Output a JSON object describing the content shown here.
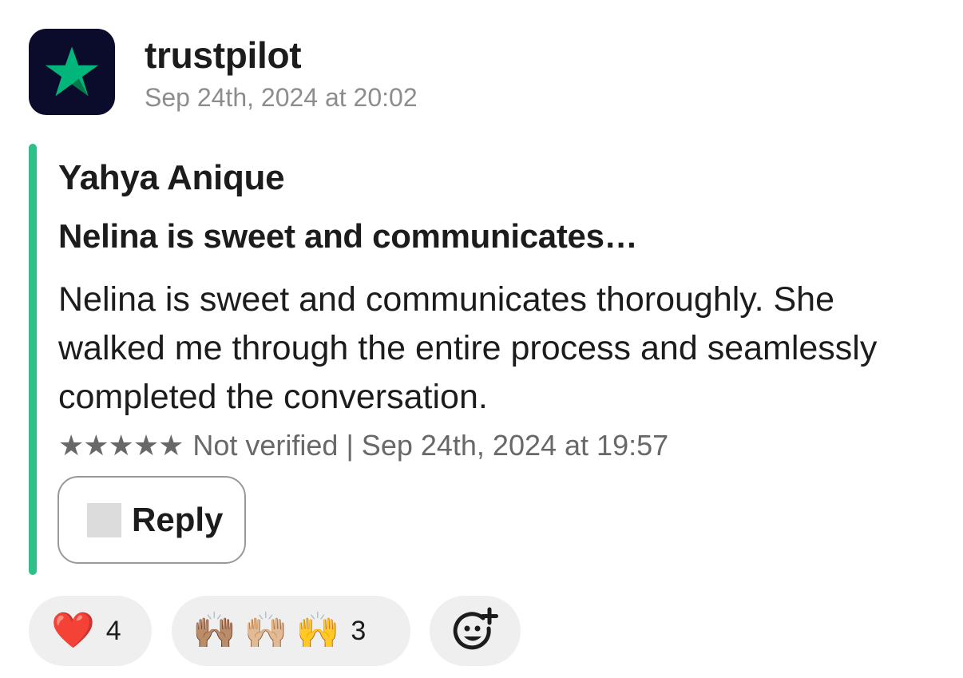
{
  "message": {
    "app_name": "trustpilot",
    "timestamp": "Sep 24th, 2024 at 20:02",
    "avatar_icon": "trustpilot-star-icon",
    "accent_color": "#2ec088"
  },
  "review": {
    "reviewer": "Yahya Anique",
    "title": "Nelina is sweet and communicates…",
    "body": "Nelina is sweet and communicates thoroughly. She walked me through the entire process and seamlessly completed the conversation.",
    "stars": "★★★★★",
    "rating": 5,
    "meta": "Not verified | Sep 24th, 2024 at 19:57"
  },
  "reply": {
    "label": "Reply",
    "icon": "reply-icon"
  },
  "reactions": [
    {
      "emoji": "❤️",
      "count": "4"
    },
    {
      "emojis": [
        "🙌🏽",
        "🙌🏼",
        "🙌"
      ],
      "count": "3"
    },
    {
      "icon": "add-reaction-icon"
    }
  ]
}
